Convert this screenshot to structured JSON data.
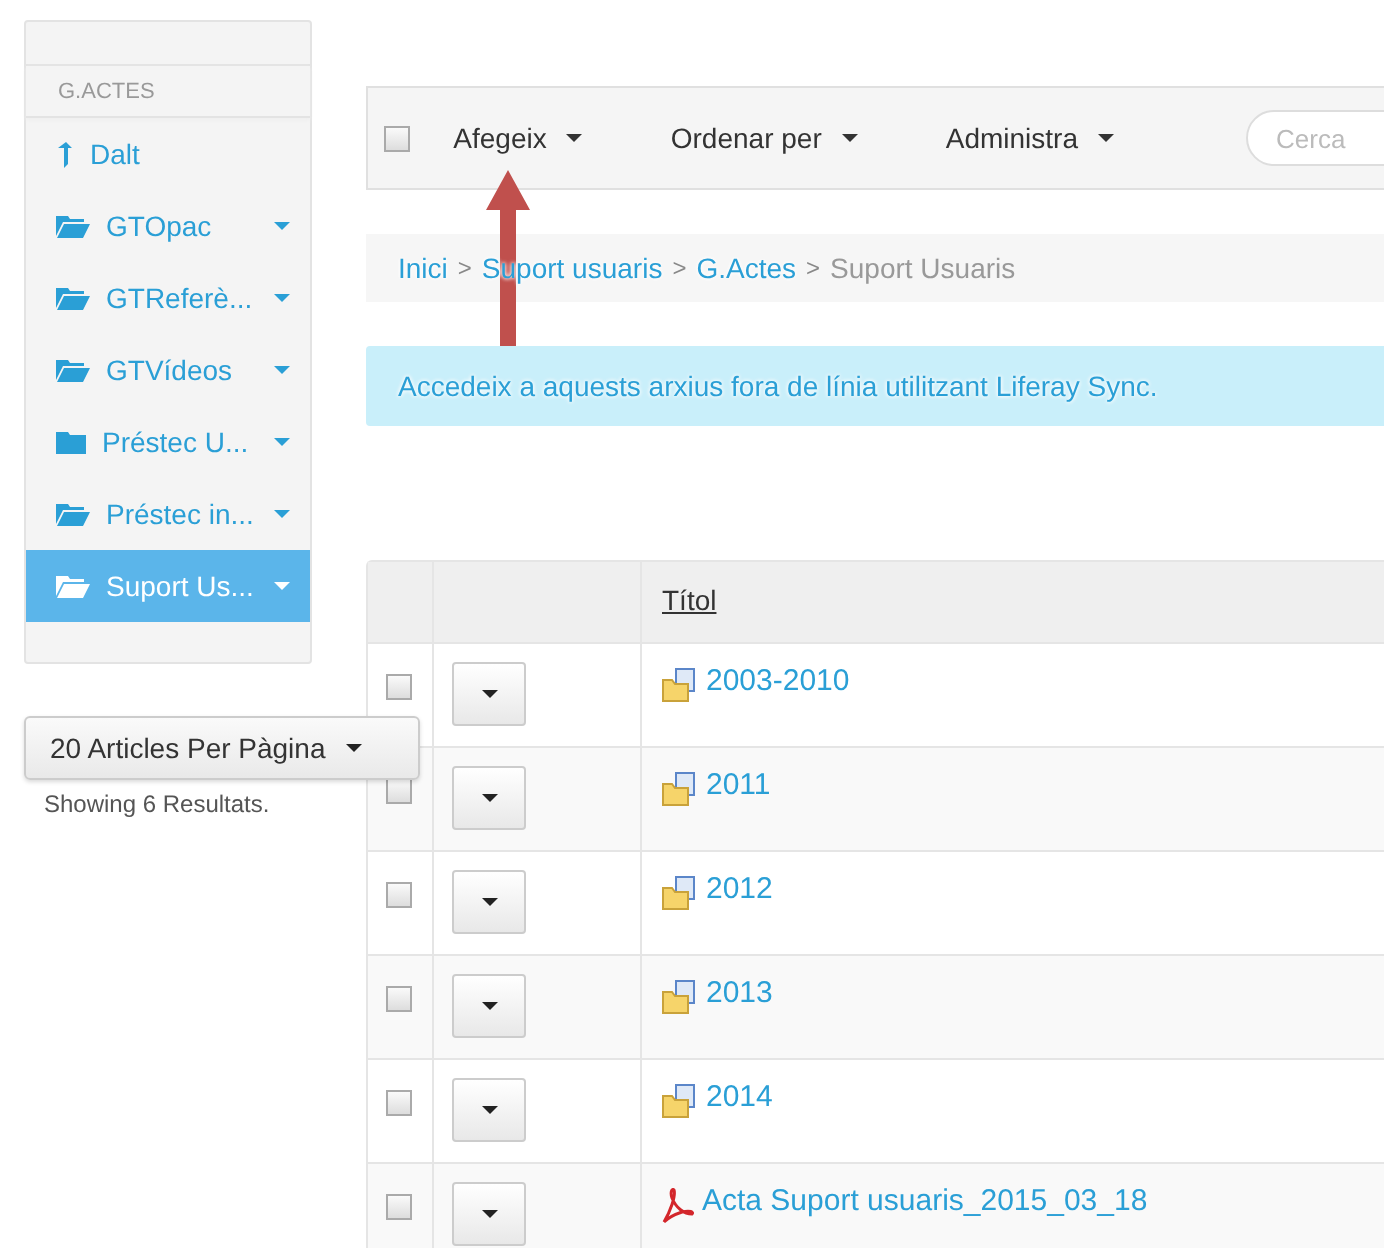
{
  "sidebar": {
    "header": "G.ACTES",
    "items": [
      {
        "label": "Dalt",
        "kind": "up",
        "has_menu": false,
        "selected": false
      },
      {
        "label": "GTOpac",
        "kind": "folder-open",
        "has_menu": true,
        "selected": false
      },
      {
        "label": "GTReferè...",
        "kind": "folder-open",
        "has_menu": true,
        "selected": false
      },
      {
        "label": "GTVídeos",
        "kind": "folder-open",
        "has_menu": true,
        "selected": false
      },
      {
        "label": "Préstec U...",
        "kind": "folder",
        "has_menu": true,
        "selected": false
      },
      {
        "label": "Préstec in...",
        "kind": "folder-open",
        "has_menu": true,
        "selected": false
      },
      {
        "label": "Suport Us...",
        "kind": "folder-open",
        "has_menu": true,
        "selected": true
      }
    ]
  },
  "per_page": {
    "label": "20 Articles Per Pàgina"
  },
  "results": "Showing 6 Resultats.",
  "toolbar": {
    "select_all": {
      "checked": false
    },
    "menus": [
      "Afegeix",
      "Ordenar per",
      "Administra"
    ],
    "search": {
      "placeholder": "Cerca"
    }
  },
  "breadcrumb": {
    "links": [
      "Inici",
      "Suport usuaris",
      "G.Actes"
    ],
    "current": "Suport Usuaris",
    "separator": ">"
  },
  "info": "Accedeix a aquests arxius fora de línia utilitzant Liferay Sync.",
  "table": {
    "columns": [
      "Títol"
    ],
    "rows": [
      {
        "title": "2003-2010",
        "kind": "folder",
        "checked": false
      },
      {
        "title": "2011",
        "kind": "folder",
        "checked": false
      },
      {
        "title": "2012",
        "kind": "folder",
        "checked": false
      },
      {
        "title": "2013",
        "kind": "folder",
        "checked": false
      },
      {
        "title": "2014",
        "kind": "folder",
        "checked": false
      },
      {
        "title": "Acta Suport usuaris_2015_03_18",
        "kind": "pdf",
        "checked": false
      }
    ]
  }
}
